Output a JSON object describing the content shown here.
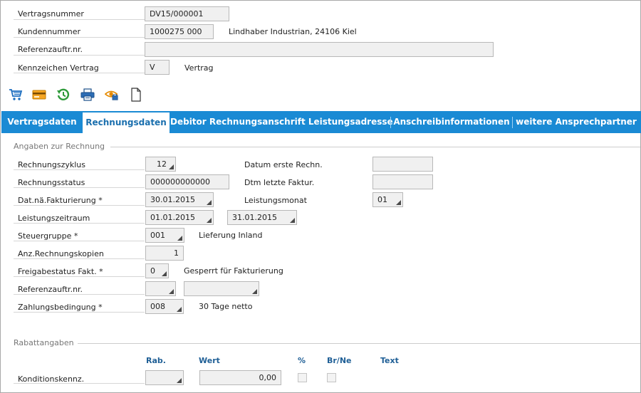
{
  "header": {
    "vertragsnummer": {
      "label": "Vertragsnummer",
      "value": "DV15/000001"
    },
    "kundennummer": {
      "label": "Kundennummer",
      "value": "1000275 000",
      "description": "Lindhaber Industrian, 24106 Kiel"
    },
    "referenzauftrag": {
      "label": "Referenzauftr.nr.",
      "value": ""
    },
    "kennzeichen": {
      "label": "Kennzeichen Vertrag",
      "value": "V",
      "description": "Vertrag"
    }
  },
  "toolbar": {
    "icons": [
      "cart-icon",
      "card-icon",
      "history-icon",
      "print-icon",
      "preview-icon",
      "document-icon"
    ]
  },
  "tabs": [
    {
      "label": "Vertragsdaten",
      "active": false
    },
    {
      "label": "Rechnungsdaten",
      "active": true
    },
    {
      "label": "Debitor Rechnungsanschrift Leistungsadresse",
      "active": false
    },
    {
      "label": "Anschreibinformationen",
      "active": false
    },
    {
      "label": "weitere Ansprechpartner",
      "active": false
    }
  ],
  "rechnung": {
    "section_title": "Angaben zur Rechnung",
    "rechnungszyklus": {
      "label": "Rechnungszyklus",
      "value": "12"
    },
    "rechnungsstatus": {
      "label": "Rechnungsstatus",
      "value": "000000000000"
    },
    "dat_fakturierung": {
      "label": "Dat.nä.Fakturierung *",
      "value": "30.01.2015"
    },
    "leistungszeitraum": {
      "label": "Leistungszeitraum",
      "from": "01.01.2015",
      "to": "31.01.2015"
    },
    "steuergruppe": {
      "label": "Steuergruppe *",
      "value": "001",
      "description": "Lieferung Inland"
    },
    "anz_kopien": {
      "label": "Anz.Rechnungskopien",
      "value": "1"
    },
    "freigabestatus": {
      "label": "Freigabestatus Fakt. *",
      "value": "0",
      "description": "Gesperrt für Fakturierung"
    },
    "referenzauftrag": {
      "label": "Referenzauftr.nr.",
      "value": "",
      "value2": ""
    },
    "zahlungsbedingung": {
      "label": "Zahlungsbedingung *",
      "value": "008",
      "description": "30 Tage netto"
    },
    "datum_erste": {
      "label": "Datum erste Rechn.",
      "value": ""
    },
    "dtm_letzte": {
      "label": "Dtm letzte Faktur.",
      "value": ""
    },
    "leistungsmonat": {
      "label": "Leistungsmonat",
      "value": "01"
    }
  },
  "rabatt": {
    "section_title": "Rabattangaben",
    "columns": {
      "rab": "Rab.",
      "wert": "Wert",
      "percent": "%",
      "brne": "Br/Ne",
      "text": "Text"
    },
    "konditionskennz": {
      "label": "Konditionskennz.",
      "rab": "",
      "wert": "0,00",
      "percent_checked": false,
      "brne_checked": false
    }
  },
  "colors": {
    "tab_bar": "#1a8ad4",
    "tab_active_text": "#1a6fae",
    "column_header": "#1f5f96"
  }
}
